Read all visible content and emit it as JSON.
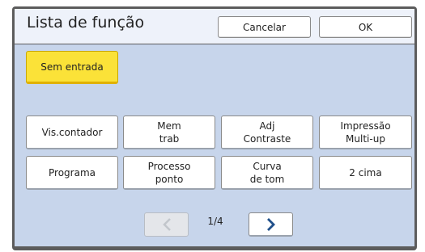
{
  "header": {
    "title": "Lista de função",
    "cancel_label": "Cancelar",
    "ok_label": "OK"
  },
  "selected_button": {
    "label": "Sem entrada",
    "color": "#fbe238"
  },
  "function_buttons": [
    {
      "label": "Vis.contador"
    },
    {
      "label": "Mem\ntrab"
    },
    {
      "label": "Adj\nContraste"
    },
    {
      "label": "Impressão\nMulti-up"
    },
    {
      "label": "Programa"
    },
    {
      "label": "Processo\nponto"
    },
    {
      "label": "Curva\nde tom"
    },
    {
      "label": "2 cima"
    }
  ],
  "pagination": {
    "indicator": "1/4",
    "prev_icon": "chevron-left-icon",
    "next_icon": "chevron-right-icon",
    "prev_enabled": false
  },
  "colors": {
    "panel": "#c7d5eb",
    "header": "#eef2fa",
    "accent_arrow": "#1f4f8a"
  }
}
